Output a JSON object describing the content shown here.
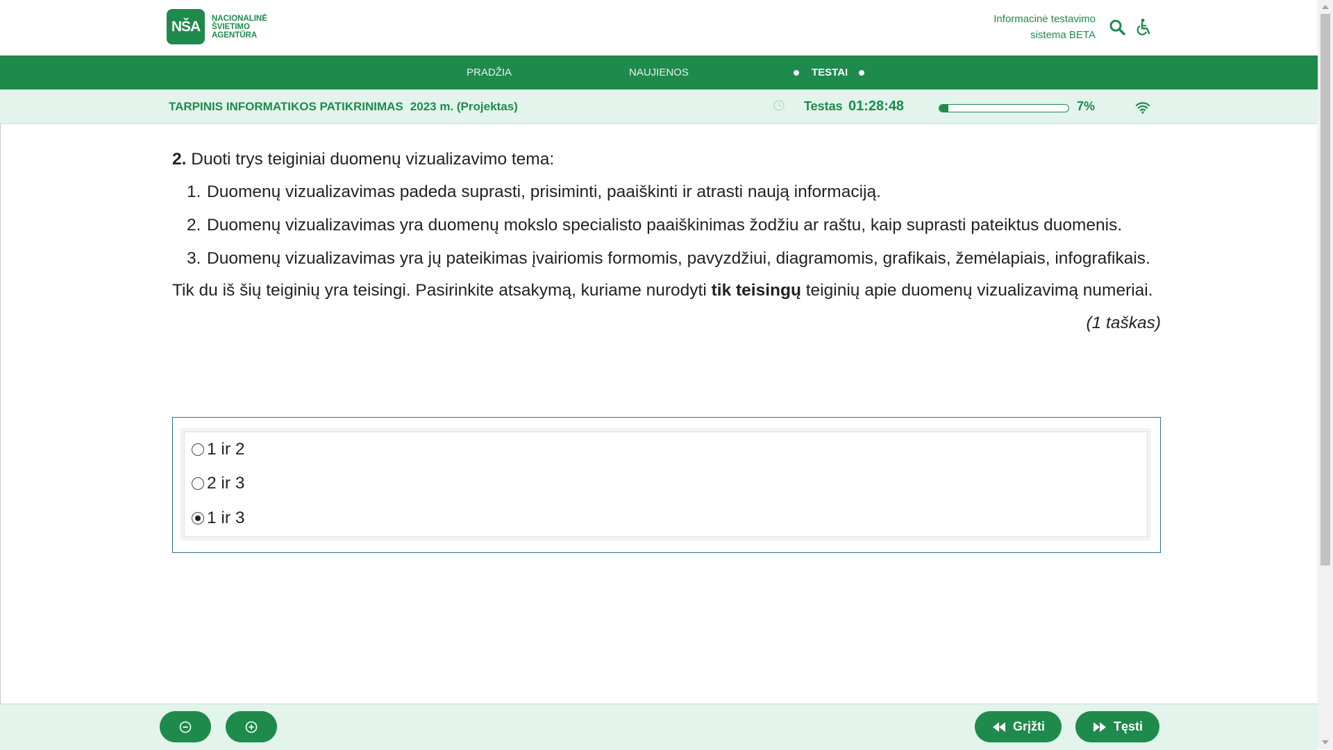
{
  "header": {
    "logo_mark": "NŠA",
    "logo_lines": [
      "Nacionalinė",
      "Švietimo",
      "Agentūra"
    ],
    "system_title_line1": "Informacinė testavimo",
    "system_title_line2": "sistema BETA",
    "search_icon": "search-icon",
    "accessibility_icon": "wheelchair-icon"
  },
  "nav": {
    "items": [
      {
        "label": "PRADŽIA",
        "active": false
      },
      {
        "label": "NAUJIENOS",
        "active": false
      },
      {
        "label": "TESTAI",
        "active": true
      }
    ]
  },
  "test_bar": {
    "title": "TARPINIS INFORMATIKOS PATIKRINIMAS",
    "year": "2023 m. (Projektas)",
    "timer_label": "Testas",
    "timer_value": "01:28:48",
    "progress_percent": 7,
    "progress_label": "7%",
    "connection_icon": "wifi-icon"
  },
  "question": {
    "number": "2.",
    "intro": "Duoti trys teiginiai duomenų vizualizavimo tema:",
    "statements": [
      {
        "n": "1.",
        "text": "Duomenų vizualizavimas padeda suprasti, prisiminti, paaiškinti ir atrasti naują informaciją."
      },
      {
        "n": "2.",
        "text": "Duomenų vizualizavimas yra duomenų mokslo specialisto paaiškinimas žodžiu ar raštu, kaip suprasti pateiktus duomenis."
      },
      {
        "n": "3.",
        "text": "Duomenų vizualizavimas yra jų pateikimas įvairiomis formomis, pavyzdžiui, diagramomis, grafikais, žemėlapiais, infografikais."
      }
    ],
    "instruction_before": "Tik du iš šių teiginių yra teisingi. Pasirinkite atsakymą, kuriame nurodyti ",
    "instruction_bold": "tik teisingų",
    "instruction_after": " teiginių apie duomenų vizualizavimą numeriai.",
    "points": "(1 taškas)"
  },
  "answers": [
    {
      "label": "1 ir 2",
      "selected": false
    },
    {
      "label": "2 ir 3",
      "selected": false
    },
    {
      "label": "1 ir 3",
      "selected": true
    }
  ],
  "footer": {
    "zoom_out_icon": "zoom-out-icon",
    "zoom_in_icon": "zoom-in-icon",
    "back_label": "Grįžti",
    "next_label": "Tęsti"
  },
  "colors": {
    "brand_green": "#1e8a4c",
    "light_green": "#e3f4ec",
    "answer_border": "#2a6f96"
  }
}
